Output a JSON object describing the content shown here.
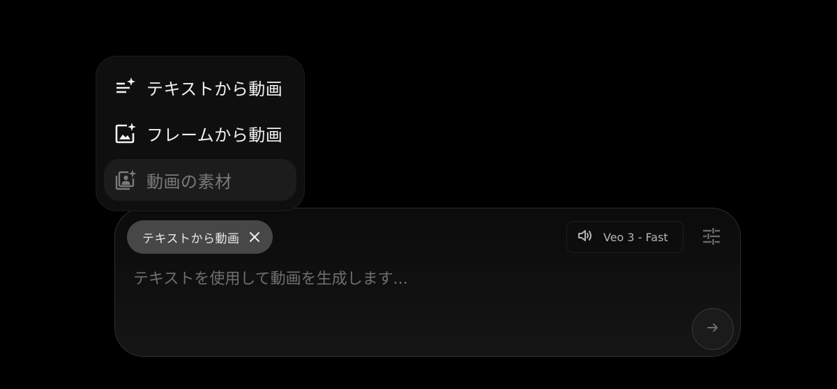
{
  "menu": {
    "items": [
      {
        "label": "テキストから動画",
        "icon": "text-sparkle-icon",
        "state": "enabled"
      },
      {
        "label": "フレームから動画",
        "icon": "image-sparkle-icon",
        "state": "enabled"
      },
      {
        "label": "動画の素材",
        "icon": "portrait-sparkle-icon",
        "state": "disabled"
      }
    ]
  },
  "composer": {
    "mode_chip": {
      "label": "テキストから動画"
    },
    "model": {
      "label": "Veo 3 - Fast",
      "icon": "volume-icon"
    },
    "settings_icon": "tune-icon",
    "prompt": {
      "value": "",
      "placeholder": "テキストを使用して動画を生成します..."
    },
    "send_icon": "arrow-right-icon"
  },
  "colors": {
    "background": "#000000",
    "chip": "#474747",
    "muted_text": "#6f6f6f"
  }
}
